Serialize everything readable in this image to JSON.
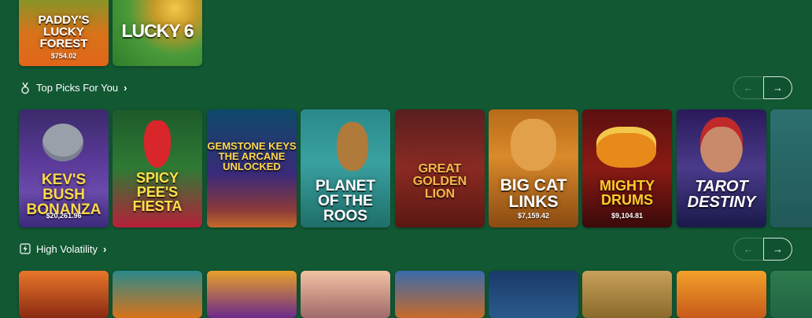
{
  "top_row": [
    {
      "title": "PADDY'S\nLUCKY\nFOREST",
      "jackpot": "$754.02"
    },
    {
      "title": "LUCKY 6",
      "jackpot": ""
    }
  ],
  "top_picks": {
    "title": "Top Picks For You",
    "icon": "medal-icon",
    "prev_icon": "←",
    "next_icon": "→",
    "games": [
      {
        "title": "KEV'S\nBUSH\nBONANZA",
        "jackpot": "$20,261.96"
      },
      {
        "title": "SPICY\nPEE'S\nFIESTA",
        "jackpot": ""
      },
      {
        "title": "GEMSTONE KEYS\nTHE ARCANE\nUNLOCKED",
        "jackpot": ""
      },
      {
        "title": "PLANET\nOF THE\nROOS",
        "jackpot": ""
      },
      {
        "title": "GREAT\nGOLDEN\nLION",
        "jackpot": ""
      },
      {
        "title": "BIG CAT\nLINKS",
        "jackpot": "$7,159.42"
      },
      {
        "title": "MIGHTY\nDRUMS",
        "jackpot": "$9,104.81"
      },
      {
        "title": "TAROT\nDESTINY",
        "jackpot": ""
      }
    ]
  },
  "high_volatility": {
    "title": "High Volatility",
    "icon": "lightning-icon",
    "prev_icon": "←",
    "next_icon": "→"
  },
  "colors": {
    "background": "#115833"
  }
}
